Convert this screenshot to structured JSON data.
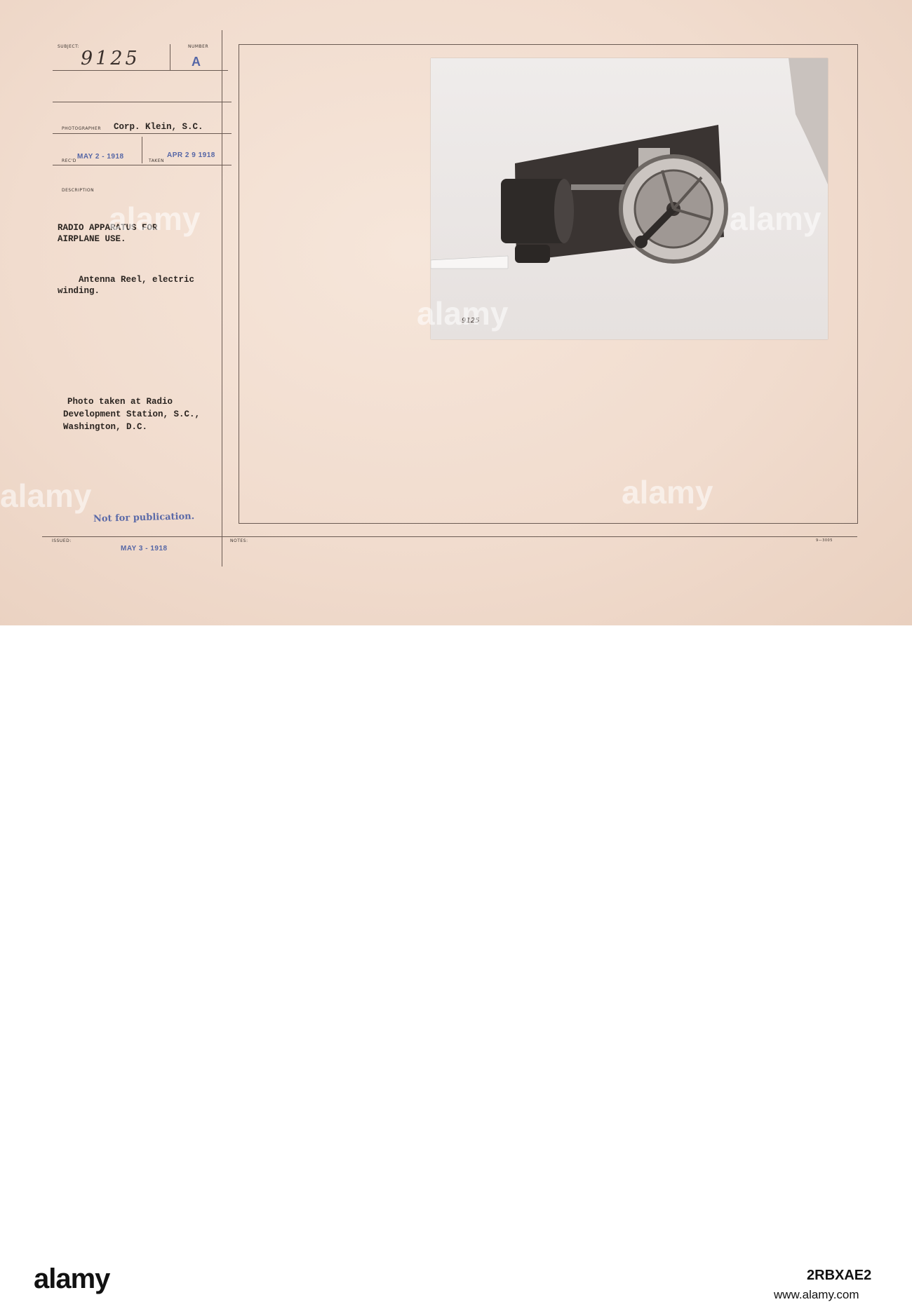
{
  "card": {
    "labels": {
      "subject": "SUBJECT:",
      "number": "NUMBER",
      "photographer": "PHOTOGRAPHER",
      "recd": "REC'D",
      "taken": "TAKEN",
      "description": "DESCRIPTION",
      "issued": "ISSUED:",
      "notes": "NOTES:"
    },
    "subject_number": "9125",
    "number_value": "A",
    "photographer": "Corp. Klein, S.C.",
    "recd_date": "MAY 2 - 1918",
    "taken_date": "APR 2 9 1918",
    "description_lines": [
      "RADIO APPARATUS FOR",
      "AIRPLANE USE.",
      "    Antenna Reel, electric",
      "winding.",
      "    Photo taken at Radio",
      "Development Station, S.C.,",
      "Washington, D.C."
    ],
    "stamp_not_for_publication": "Not for publication.",
    "issued_date": "MAY 3 - 1918",
    "form_number": "9—3005",
    "photo_number": "9125"
  },
  "footer": {
    "brand": "alamy",
    "image_id": "2RBXAE2",
    "site": "www.alamy.com"
  },
  "watermark": "alamy"
}
